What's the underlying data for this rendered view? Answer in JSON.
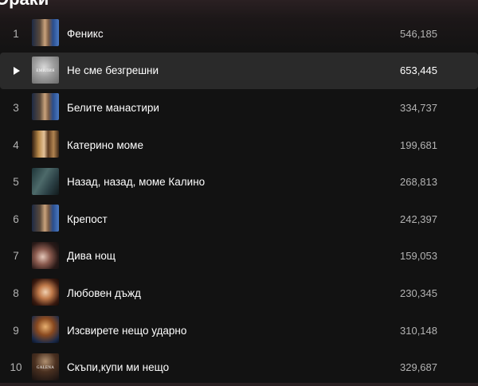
{
  "section": {
    "heading": "Ораки"
  },
  "tracks": [
    {
      "index": "1",
      "title": "Феникс",
      "plays": "546,185",
      "cover": "cover-a",
      "cover_text": "",
      "hovered": false
    },
    {
      "index": "2",
      "title": "Не сме безгрешни",
      "plays": "653,445",
      "cover": "cover-b",
      "cover_text": "ЕМИЛИЯ",
      "hovered": true
    },
    {
      "index": "3",
      "title": "Белите манастири",
      "plays": "334,737",
      "cover": "cover-a",
      "cover_text": "",
      "hovered": false
    },
    {
      "index": "4",
      "title": "Катерино моме",
      "plays": "199,681",
      "cover": "cover-c",
      "cover_text": "",
      "hovered": false
    },
    {
      "index": "5",
      "title": "Назад, назад, моме Калино",
      "plays": "268,813",
      "cover": "cover-d",
      "cover_text": "",
      "hovered": false
    },
    {
      "index": "6",
      "title": "Крепост",
      "plays": "242,397",
      "cover": "cover-a",
      "cover_text": "",
      "hovered": false
    },
    {
      "index": "7",
      "title": "Дива нощ",
      "plays": "159,053",
      "cover": "cover-e",
      "cover_text": "",
      "hovered": false
    },
    {
      "index": "8",
      "title": "Любовен дъжд",
      "plays": "230,345",
      "cover": "cover-f",
      "cover_text": "",
      "hovered": false
    },
    {
      "index": "9",
      "title": "Изсвирете нещо ударно",
      "plays": "310,148",
      "cover": "cover-g",
      "cover_text": "",
      "hovered": false
    },
    {
      "index": "10",
      "title": "Скъпи,купи ми нещо",
      "plays": "329,687",
      "cover": "cover-h",
      "cover_text": "GALENA",
      "hovered": false
    }
  ],
  "icons": {
    "hover_play": "play-icon"
  },
  "colors": {
    "background": "#121212",
    "row_hover": "#2a2a2a",
    "text_primary": "#ffffff",
    "text_secondary": "#b3b3b3"
  }
}
